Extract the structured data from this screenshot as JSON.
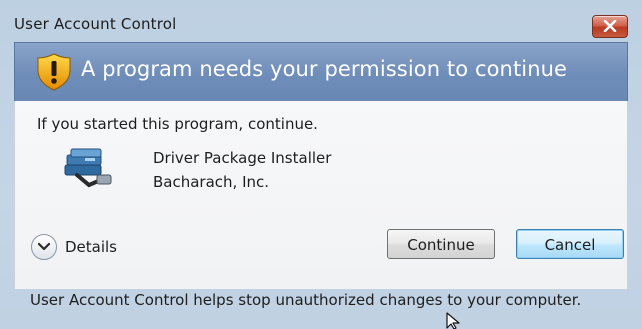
{
  "window": {
    "title": "User Account Control"
  },
  "banner": {
    "heading": "A program needs your permission to continue"
  },
  "body": {
    "intro": "If you started this program, continue.",
    "program_name": "Driver Package Installer",
    "publisher": "Bacharach, Inc."
  },
  "details": {
    "label": "Details"
  },
  "buttons": {
    "continue_label": "Continue",
    "cancel_label": "Cancel"
  },
  "footer": {
    "text": "User Account Control helps stop unauthorized changes to your computer."
  },
  "icons": {
    "title_close": "close-icon",
    "banner": "shield-warning-icon",
    "program": "installer-icon",
    "details": "chevron-down-icon",
    "pointer": "mouse-cursor-icon"
  },
  "colors": {
    "banner": "#6f8db9",
    "close_button": "#c65a3e",
    "default_button_border": "#3c7fb1"
  }
}
